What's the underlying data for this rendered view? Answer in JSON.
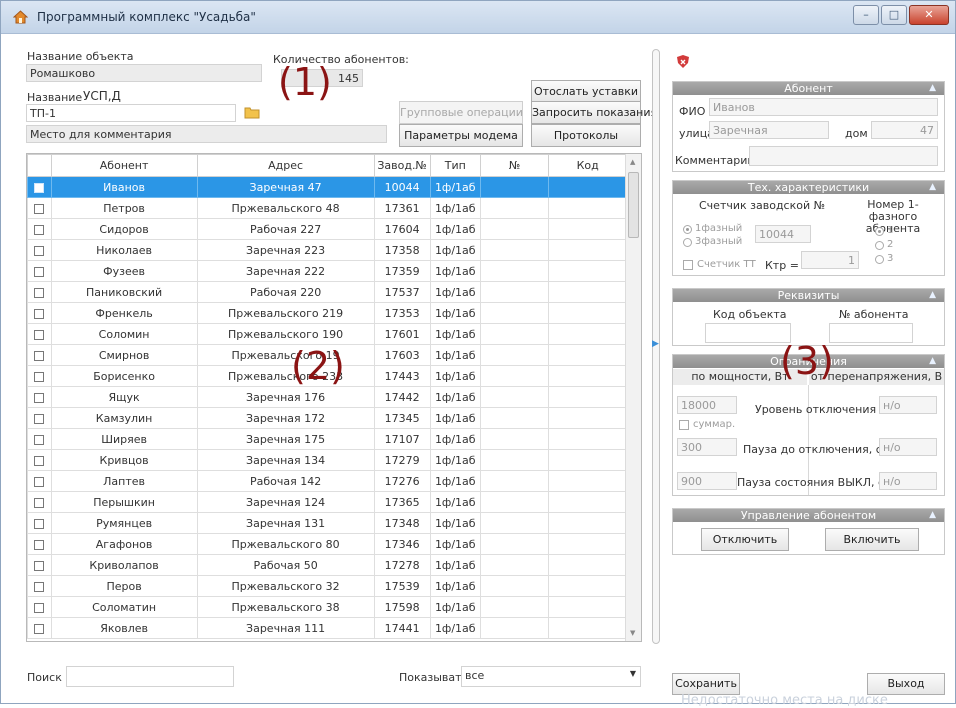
{
  "window": {
    "title": "Программный комплекс \"Усадьба\"",
    "minimize": "–",
    "maximize": "□",
    "close": "✕"
  },
  "header": {
    "object_name_label": "Название объекта",
    "object_name_value": "Ромашково",
    "name_label": "Название",
    "name_value": "УСП,Д",
    "name_field": "ТП-1",
    "comment_placeholder": "Место для комментария",
    "subscriber_count_label": "Количество абонентов:",
    "subscriber_count_value": "145"
  },
  "buttons": {
    "send_settings": "Отослать уставки",
    "group_ops": "Групповые операции",
    "request_readings": "Запросить показания",
    "modem_params": "Параметры модема",
    "protocols": "Протоколы"
  },
  "annotations": {
    "one": "(1)",
    "two": "(2)",
    "three": "(3)"
  },
  "table": {
    "columns": [
      "",
      "Абонент",
      "Адрес",
      "Завод.№",
      "Тип",
      "№",
      "Код"
    ],
    "rows": [
      {
        "name": "Иванов",
        "address": "Заречная 47",
        "serial": "10044",
        "type": "1ф/1аб",
        "num": "",
        "code": ""
      },
      {
        "name": "Петров",
        "address": "Пржевальского 48",
        "serial": "17361",
        "type": "1ф/1аб",
        "num": "",
        "code": ""
      },
      {
        "name": "Сидоров",
        "address": "Рабочая 227",
        "serial": "17604",
        "type": "1ф/1аб",
        "num": "",
        "code": ""
      },
      {
        "name": "Николаев",
        "address": "Заречная 223",
        "serial": "17358",
        "type": "1ф/1аб",
        "num": "",
        "code": ""
      },
      {
        "name": "Фузеев",
        "address": "Заречная 222",
        "serial": "17359",
        "type": "1ф/1аб",
        "num": "",
        "code": ""
      },
      {
        "name": "Паниковский",
        "address": "Рабочая 220",
        "serial": "17537",
        "type": "1ф/1аб",
        "num": "",
        "code": ""
      },
      {
        "name": "Френкель",
        "address": "Пржевальского 219",
        "serial": "17353",
        "type": "1ф/1аб",
        "num": "",
        "code": ""
      },
      {
        "name": "Соломин",
        "address": "Пржевальского 190",
        "serial": "17601",
        "type": "1ф/1аб",
        "num": "",
        "code": ""
      },
      {
        "name": "Смирнов",
        "address": "Пржевальского 19",
        "serial": "17603",
        "type": "1ф/1аб",
        "num": "",
        "code": ""
      },
      {
        "name": "Борисенко",
        "address": "Пржевальского 233",
        "serial": "17443",
        "type": "1ф/1аб",
        "num": "",
        "code": ""
      },
      {
        "name": "Ящук",
        "address": "Заречная 176",
        "serial": "17442",
        "type": "1ф/1аб",
        "num": "",
        "code": ""
      },
      {
        "name": "Камзулин",
        "address": "Заречная 172",
        "serial": "17345",
        "type": "1ф/1аб",
        "num": "",
        "code": ""
      },
      {
        "name": "Ширяев",
        "address": "Заречная 175",
        "serial": "17107",
        "type": "1ф/1аб",
        "num": "",
        "code": ""
      },
      {
        "name": "Кривцов",
        "address": "Заречная 134",
        "serial": "17279",
        "type": "1ф/1аб",
        "num": "",
        "code": ""
      },
      {
        "name": "Лаптев",
        "address": "Рабочая 142",
        "serial": "17276",
        "type": "1ф/1аб",
        "num": "",
        "code": ""
      },
      {
        "name": "Перышкин",
        "address": "Заречная 124",
        "serial": "17365",
        "type": "1ф/1аб",
        "num": "",
        "code": ""
      },
      {
        "name": "Румянцев",
        "address": "Заречная 131",
        "serial": "17348",
        "type": "1ф/1аб",
        "num": "",
        "code": ""
      },
      {
        "name": "Агафонов",
        "address": "Пржевальского 80",
        "serial": "17346",
        "type": "1ф/1аб",
        "num": "",
        "code": ""
      },
      {
        "name": "Криволапов",
        "address": "Рабочая 50",
        "serial": "17278",
        "type": "1ф/1аб",
        "num": "",
        "code": ""
      },
      {
        "name": "Перов",
        "address": "Пржевальского 32",
        "serial": "17539",
        "type": "1ф/1аб",
        "num": "",
        "code": ""
      },
      {
        "name": "Соломатин",
        "address": "Пржевальского 38",
        "serial": "17598",
        "type": "1ф/1аб",
        "num": "",
        "code": ""
      },
      {
        "name": "Яковлев",
        "address": "Заречная 111",
        "serial": "17441",
        "type": "1ф/1аб",
        "num": "",
        "code": ""
      }
    ]
  },
  "footer": {
    "search_label": "Поиск",
    "search_value": "",
    "show_label": "Показывать",
    "show_value": "все"
  },
  "subscriber": {
    "header": "Абонент",
    "fio_label": "ФИО",
    "fio_value": "Иванов",
    "street_label": "улица",
    "street_value": "Заречная",
    "house_label": "дом",
    "house_value": "47",
    "comment_label": "Комментарий",
    "comment_value": ""
  },
  "tech": {
    "header": "Тех. характеристики",
    "meter_label": "Счетчик заводской №",
    "phase_label": "Номер 1-фазного абонента",
    "radio_1phase": "1фазный",
    "radio_3phase": "3фазный",
    "serial_value": "10044",
    "meter_tt_label": "Счетчик ТТ",
    "ktr_label": "Ктр =",
    "ktr_value": "1",
    "phase_opt1": "1",
    "phase_opt2": "2",
    "phase_opt3": "3"
  },
  "requisites": {
    "header": "Реквизиты",
    "object_code_label": "Код объекта",
    "subscriber_num_label": "№ абонента",
    "object_code_value": "",
    "subscriber_num_value": ""
  },
  "limits": {
    "header": "Ограничения",
    "col_power": "по мощности, Вт",
    "col_voltage": "от перенапряжения, В",
    "power_value": "18000",
    "summ_label": "суммар.",
    "level_label": "Уровень отключения",
    "level_value": "н/о",
    "pause_before_value": "300",
    "pause_before_label": "Пауза до отключения, сек",
    "pause_before_v": "н/о",
    "pause_off_value": "900",
    "pause_off_label": "Пауза состояния ВЫКЛ, сек",
    "pause_off_v": "н/о"
  },
  "control": {
    "header": "Управление абонентом",
    "disconnect": "Отключить",
    "connect": "Включить"
  },
  "bottom": {
    "save": "Сохранить",
    "exit": "Выход",
    "status": "Недостаточно места на диске"
  },
  "colors": {
    "selection": "#2b96e6",
    "annotation": "#8b1414",
    "panel_header": "#9a9a9a"
  }
}
